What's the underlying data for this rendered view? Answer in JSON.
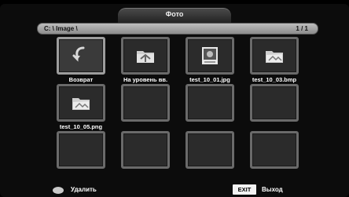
{
  "window": {
    "title": "Фото"
  },
  "pathbar": {
    "path": "C: \\ Image \\",
    "page_indicator": "1 / 1"
  },
  "items": [
    {
      "label": "Возврат",
      "icon": "return-arrow-icon"
    },
    {
      "label": "На уровень вв.",
      "icon": "folder-up-icon"
    },
    {
      "label": "test_10_01.jpg",
      "icon": "jpg-image-icon"
    },
    {
      "label": "test_10_03.bmp",
      "icon": "bmp-image-icon"
    },
    {
      "label": "test_10_05.png",
      "icon": "png-image-icon"
    }
  ],
  "footer": {
    "delete_label": "Удалить",
    "exit_key": "EXIT",
    "exit_label": "Выход"
  }
}
